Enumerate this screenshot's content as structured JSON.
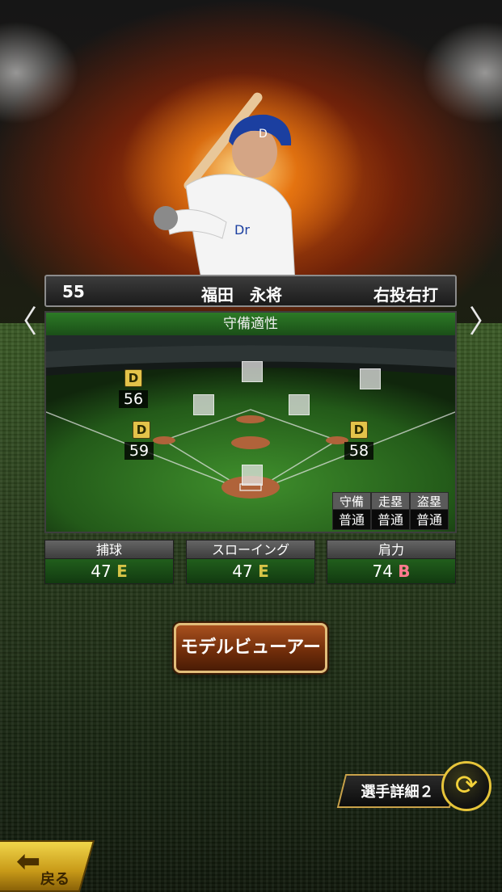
{
  "player": {
    "number": "55",
    "name": "福田　永将",
    "throw_bat": "右投右打"
  },
  "nav": {
    "prev_arrow": "〈",
    "next_arrow": "〉"
  },
  "defense": {
    "title": "守備適性",
    "positions": [
      {
        "pos": "left-field",
        "grade": "D",
        "value": "56"
      },
      {
        "pos": "third-base",
        "grade": "D",
        "value": "59"
      },
      {
        "pos": "first-base",
        "grade": "D",
        "value": "58"
      }
    ],
    "aptitude": [
      {
        "label": "守備",
        "value": "普通"
      },
      {
        "label": "走塁",
        "value": "普通"
      },
      {
        "label": "盗塁",
        "value": "普通"
      }
    ]
  },
  "stats": [
    {
      "label": "捕球",
      "value": "47",
      "grade": "E"
    },
    {
      "label": "スローイング",
      "value": "47",
      "grade": "E"
    },
    {
      "label": "肩力",
      "value": "74",
      "grade": "B"
    }
  ],
  "buttons": {
    "model_viewer": "モデルビューアー",
    "player_detail": "選手詳細２",
    "back": "戻る"
  },
  "colors": {
    "grade_badge": "#e3c34a",
    "grade_e": "#d7c447",
    "grade_b": "#ff7a8e",
    "header_green": "#2c7a26"
  }
}
